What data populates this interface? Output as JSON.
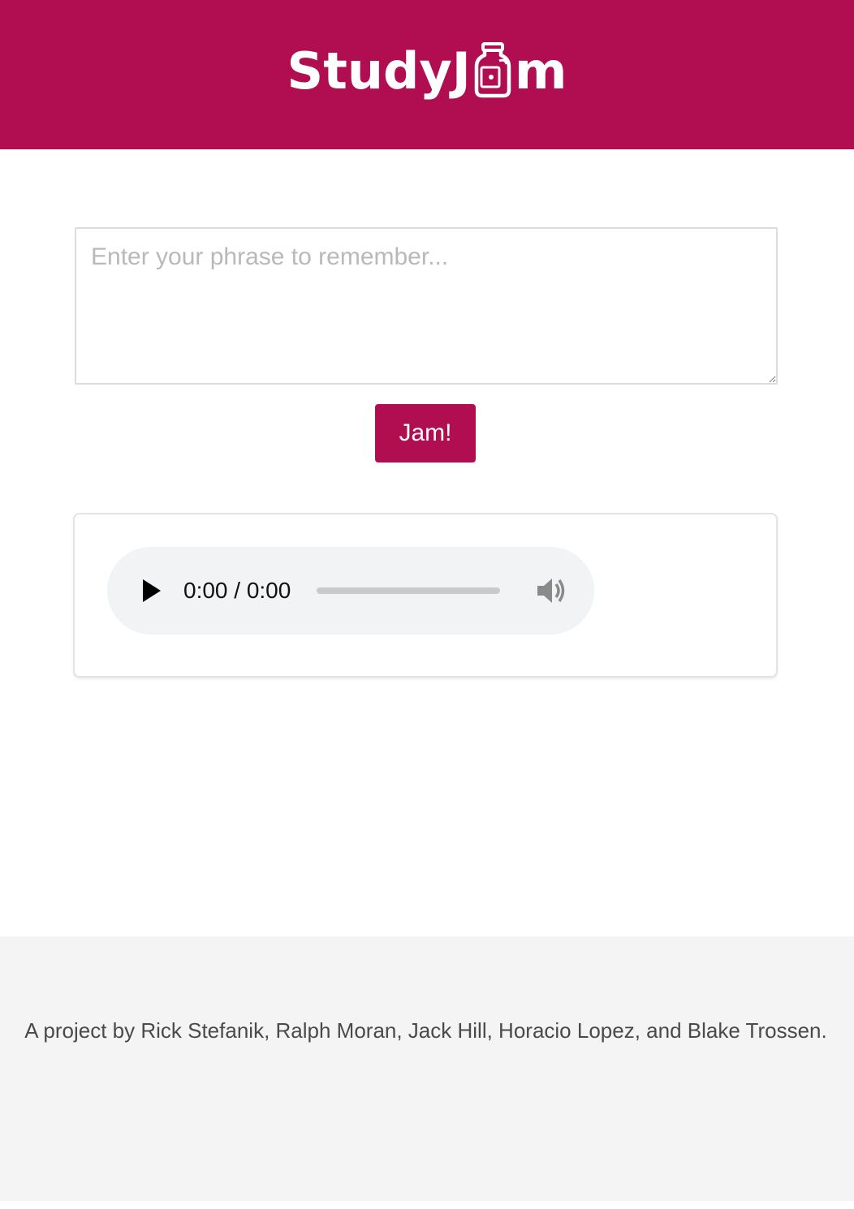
{
  "header": {
    "logo_left": "StudyJ",
    "logo_right": "m",
    "background_color": "#b10d51"
  },
  "phrase_input": {
    "placeholder": "Enter your phrase to remember...",
    "value": ""
  },
  "jam_button": {
    "label": "Jam!"
  },
  "audio_player": {
    "time_display": "0:00 / 0:00",
    "progress": 0,
    "play_icon": "play-icon",
    "volume_icon": "volume-icon"
  },
  "footer": {
    "credits": "A project by Rick Stefanik, Ralph Moran, Jack Hill, Horacio Lopez, and Blake Trossen."
  }
}
